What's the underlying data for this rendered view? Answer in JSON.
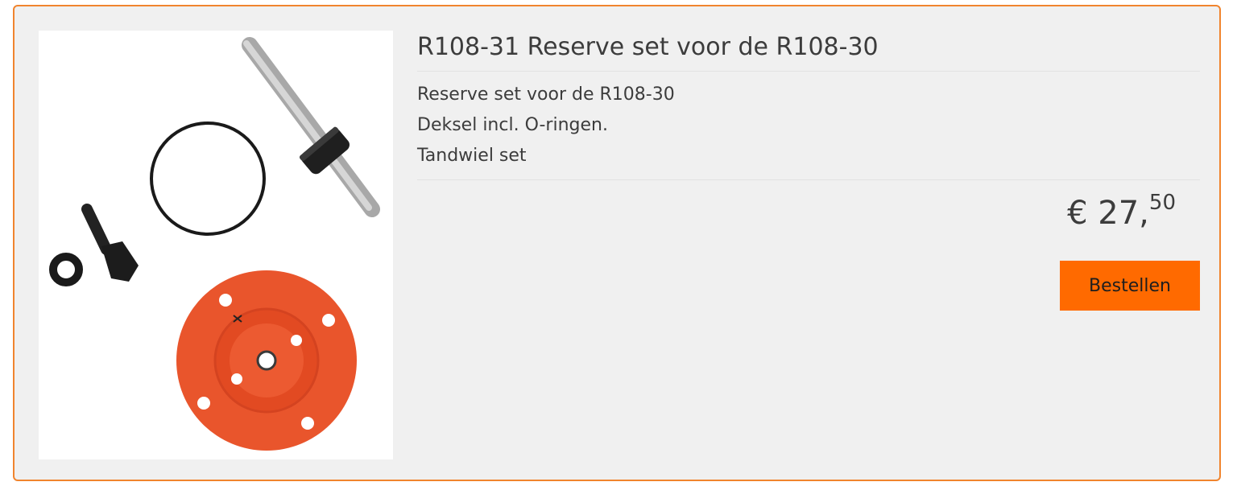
{
  "product": {
    "title": "R108-31 Reserve set voor de R108-30",
    "description": [
      "Reserve set voor de R108-30",
      "Deksel incl. O-ringen.",
      "Tandwiel set"
    ],
    "price": {
      "currency": "€",
      "whole": "27,",
      "cents": "50"
    },
    "order_label": "Bestellen",
    "image_icon": "spare-parts-photo"
  },
  "colors": {
    "accent": "#ff6a00",
    "card_border": "#f0842e",
    "card_background": "#f0f0f0",
    "text": "#3c3c3c"
  }
}
